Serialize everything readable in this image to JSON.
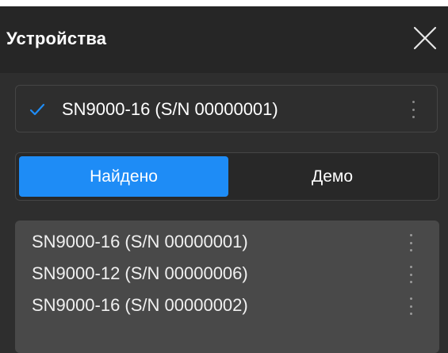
{
  "dialog": {
    "title": "Устройства",
    "close_icon": "close-icon"
  },
  "connected_device": {
    "label": "SN9000-16 (S/N 00000001)",
    "status_icon": "check-icon",
    "menu_icon": "kebab-menu-icon",
    "accent_color": "#1e8cf6"
  },
  "tabs": [
    {
      "label": "Найдено",
      "active": true
    },
    {
      "label": "Демо",
      "active": false
    }
  ],
  "device_list": {
    "items": [
      {
        "label": "SN9000-16 (S/N 00000001)"
      },
      {
        "label": "SN9000-12 (S/N 00000006)"
      },
      {
        "label": "SN9000-16 (S/N 00000002)"
      }
    ],
    "item_menu_icon": "kebab-menu-icon"
  },
  "colors": {
    "accent": "#1e8cf6",
    "panel_bg": "#2e2e2e",
    "header_bg": "#262626",
    "list_bg": "#494949"
  }
}
